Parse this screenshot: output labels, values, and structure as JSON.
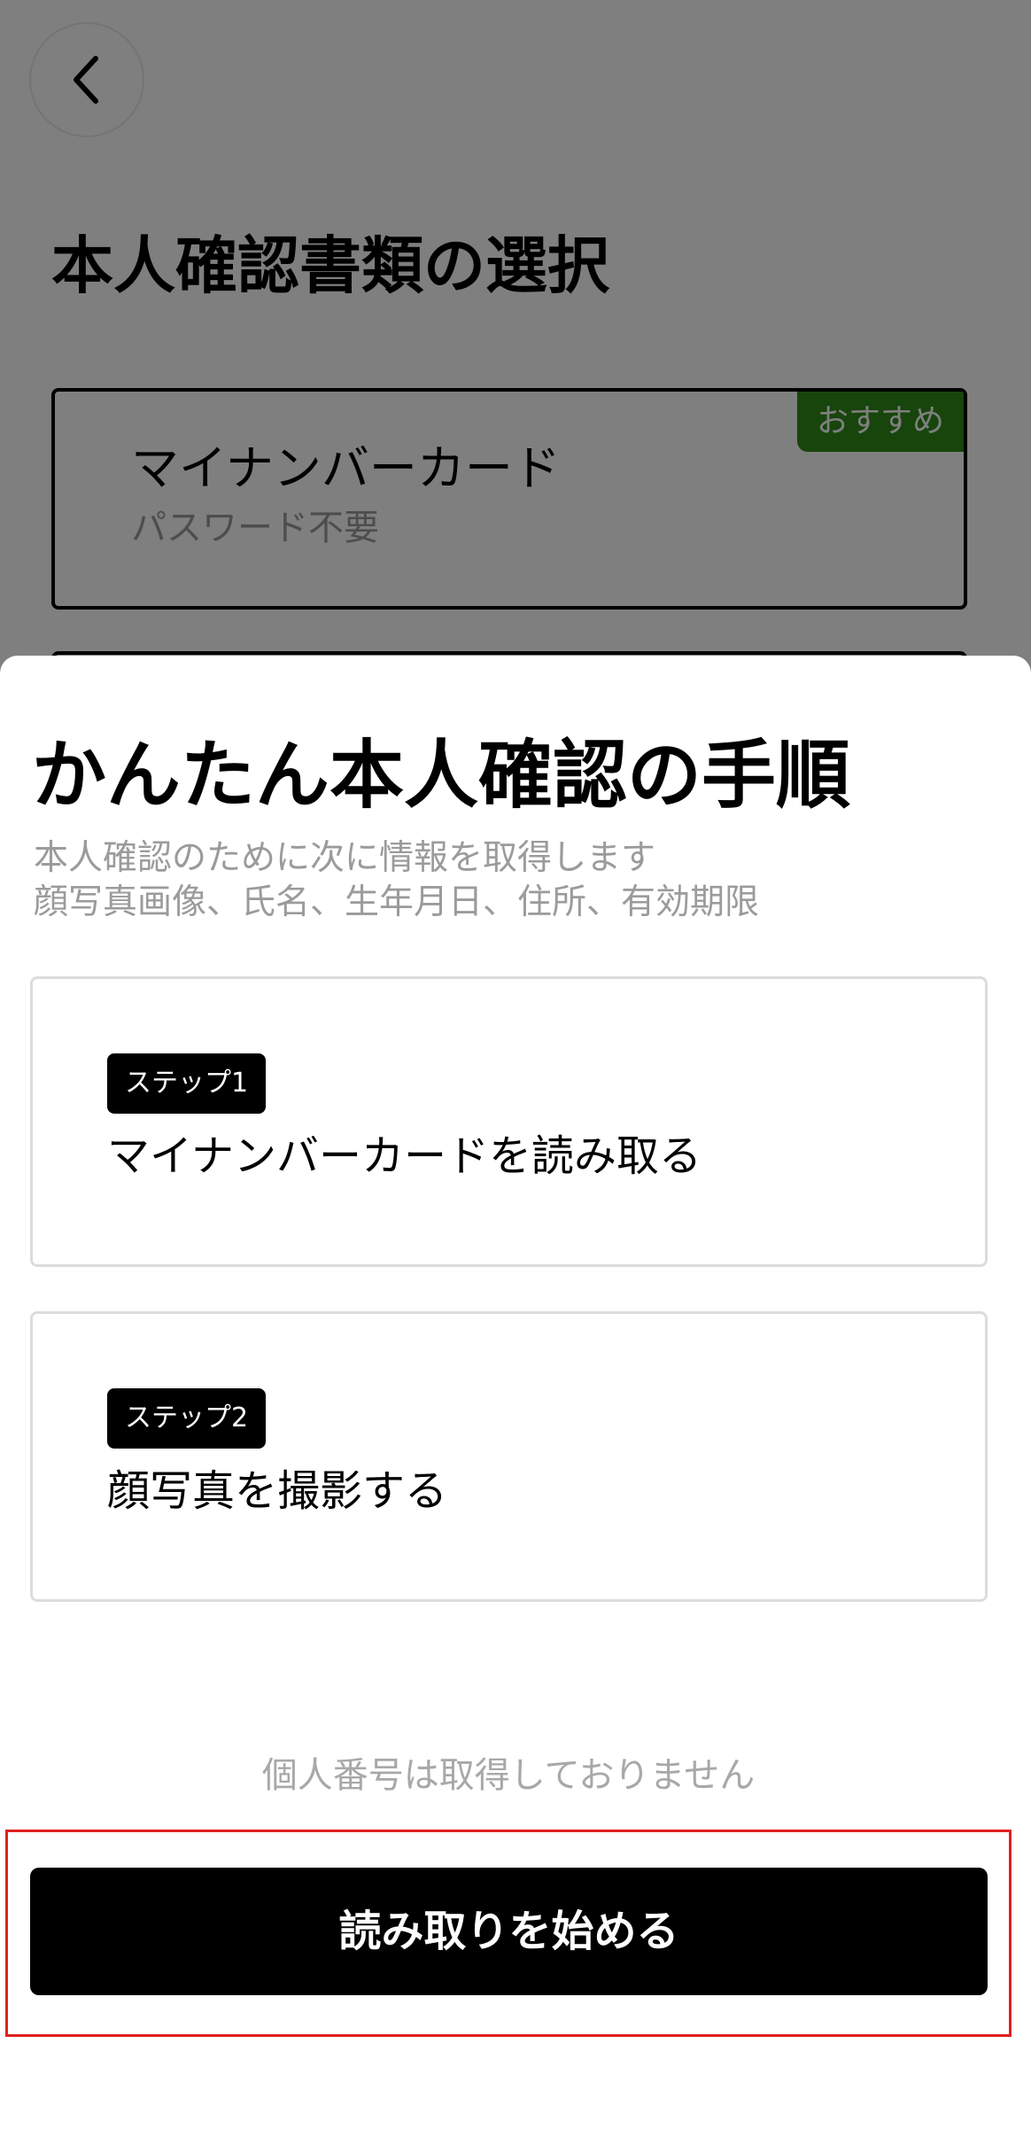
{
  "background": {
    "title": "本人確認書類の選択",
    "document_option": {
      "title": "マイナンバーカード",
      "subtitle": "パスワード不要",
      "badge": "おすすめ"
    }
  },
  "sheet": {
    "title": "かんたん本人確認の手順",
    "description_line1": "本人確認のために次に情報を取得します",
    "description_line2": "顔写真画像、氏名、生年月日、住所、有効期限",
    "steps": [
      {
        "badge": "ステップ1",
        "text": "マイナンバーカードを読み取る"
      },
      {
        "badge": "ステップ2",
        "text": "顔写真を撮影する"
      }
    ],
    "privacy_note": "個人番号は取得しておりません",
    "start_button_label": "読み取りを始める"
  },
  "colors": {
    "badge_green": "#2f8a18",
    "highlight_red": "#e02020",
    "button_black": "#000000"
  },
  "icons": {
    "back": "chevron-left-icon"
  }
}
